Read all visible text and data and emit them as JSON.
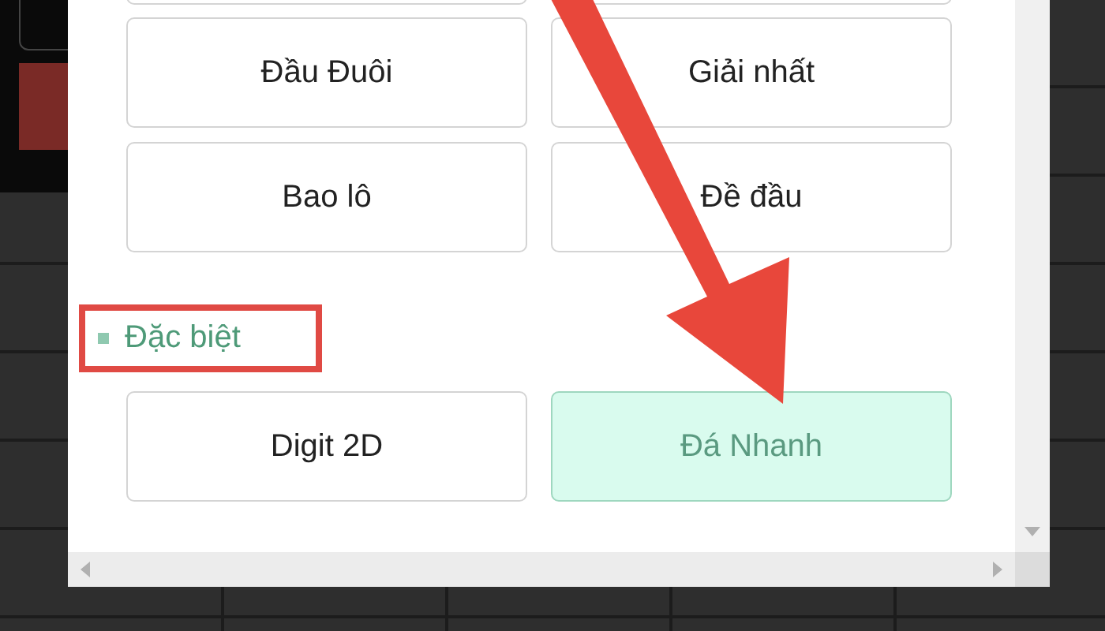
{
  "options": [
    {
      "label": "Đầu Đuôi",
      "selected": false
    },
    {
      "label": "Giải nhất",
      "selected": false
    },
    {
      "label": "Bao lô",
      "selected": false
    },
    {
      "label": "Đề đầu",
      "selected": false
    }
  ],
  "special_section": {
    "title": "Đặc biệt",
    "highlighted": true,
    "options": [
      {
        "label": "Digit 2D",
        "selected": false
      },
      {
        "label": "Đá Nhanh",
        "selected": true
      }
    ]
  },
  "annotations": [
    {
      "kind": "arrow"
    }
  ]
}
